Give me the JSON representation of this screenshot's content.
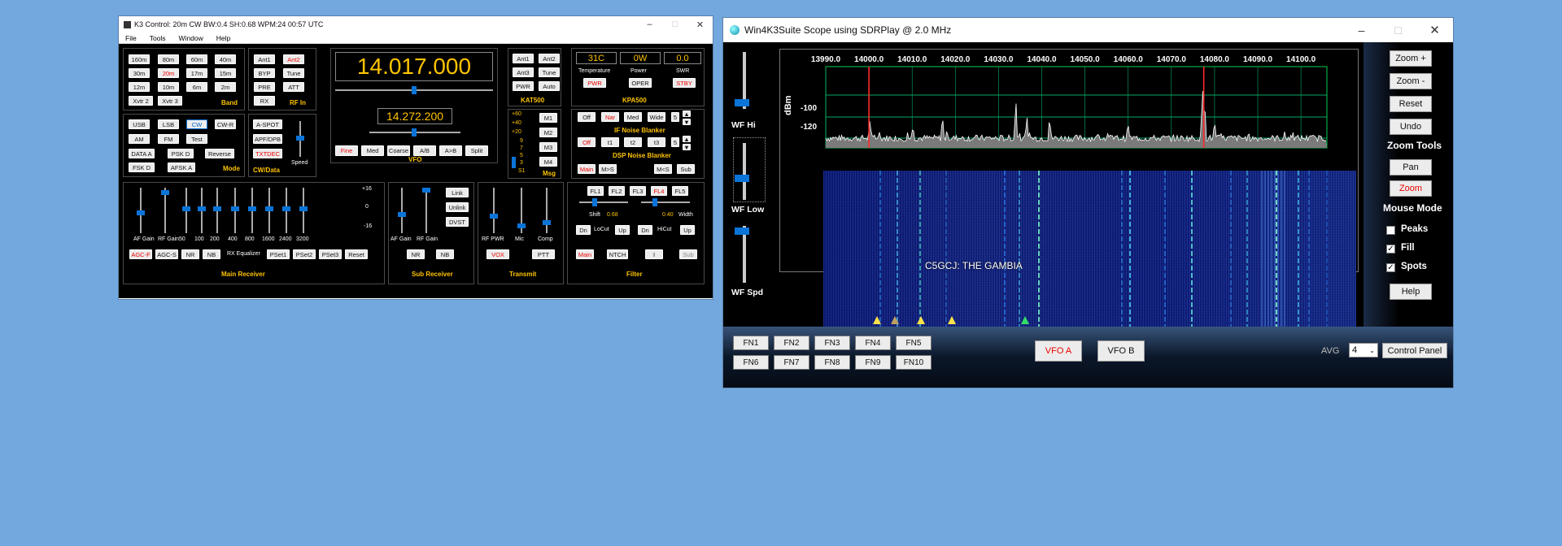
{
  "k3": {
    "title": "K3 Control: 20m CW BW:0.4 SH:0.68 WPM:24  00:57 UTC",
    "menu": [
      "File",
      "Tools",
      "Window",
      "Help"
    ],
    "band": {
      "label": "Band",
      "buttons": [
        "160m",
        "80m",
        "60m",
        "40m",
        "30m",
        "20m",
        "17m",
        "15m",
        "12m",
        "10m",
        "6m",
        "2m",
        "Xvtr 2",
        "Xvtr 3"
      ]
    },
    "rfin": {
      "label": "RF In",
      "buttons": [
        "Ant1",
        "Ant2",
        "BYP",
        "Tune",
        "PRE",
        "ATT",
        "RX"
      ]
    },
    "vfo": {
      "label": "VFO",
      "freq_a": "14.017.000",
      "freq_b": "14.272.200",
      "buttons": [
        "Fine",
        "Med",
        "Coarse",
        "A/B",
        "A>B",
        "Split"
      ]
    },
    "kat": {
      "label": "KAT500",
      "buttons": [
        "Ant1",
        "Ant2",
        "Ant3",
        "Tune",
        "PWR",
        "Auto"
      ]
    },
    "kpa": {
      "label": "KPA500",
      "temp": "31C",
      "power": "0W",
      "swr": "0.0",
      "temp_label": "Temperature",
      "power_label": "Power",
      "swr_label": "SWR",
      "buttons": [
        "PWR",
        "OPER",
        "STBY"
      ]
    },
    "mode": {
      "label": "Mode",
      "buttons": [
        "USB",
        "LSB",
        "CW",
        "CW-R",
        "AM",
        "FM",
        "Test",
        "DATA A",
        "PSK D",
        "Reverse",
        "FSK D",
        "AFSK A"
      ]
    },
    "cwdata": {
      "label": "CW/Data",
      "buttons": [
        "A-SPOT",
        "APF/DPB",
        "TXTDEC"
      ],
      "speed": "Speed"
    },
    "msg": {
      "label": "Msg",
      "buttons": [
        "M1",
        "M2",
        "M3",
        "M4"
      ],
      "meter": [
        "+60",
        "+40",
        "+20",
        "9",
        "7",
        "5",
        "3",
        "S1"
      ]
    },
    "nb": {
      "label": "IF Noise Blanker",
      "buttons": [
        "Off",
        "Nar",
        "Med",
        "Wide"
      ],
      "value": "5"
    },
    "dsp": {
      "label": "DSP Noise Blanker",
      "buttons": [
        "Off",
        "t1",
        "t2",
        "t3"
      ],
      "value": "5",
      "extra": [
        "Main",
        "M>S",
        "M<S",
        "Sub"
      ]
    },
    "mainrx": {
      "label": "Main Receiver",
      "sliders": [
        "AF Gain",
        "RF Gain",
        "50",
        "100",
        "200",
        "400",
        "800",
        "1600",
        "2400",
        "3200"
      ],
      "eq_scale": [
        "+16",
        "0",
        "-16"
      ],
      "eq_label": "RX Equalizer",
      "buttons": [
        "AGC-F",
        "AGC-S",
        "NR",
        "NB",
        "PSet1",
        "PSet2",
        "PSet3",
        "Reset"
      ]
    },
    "subrx": {
      "label": "Sub Receiver",
      "sliders": [
        "AF Gain",
        "RF Gain"
      ],
      "buttons": [
        "Link",
        "Unlink",
        "DVST",
        "NR",
        "NB"
      ]
    },
    "tx": {
      "label": "Transmit",
      "sliders": [
        "RF PWR",
        "Mic",
        "Comp"
      ],
      "buttons": [
        "VOX",
        "PTT"
      ]
    },
    "filter": {
      "label": "Filter",
      "buttons": [
        "FL1",
        "FL2",
        "FL3",
        "FL4",
        "FL5"
      ],
      "shift": "Shift",
      "shift_val": "0.68",
      "width_val": "0.40",
      "width": "Width",
      "locut": "LoCut",
      "hicut": "HiCut",
      "dn": "Dn",
      "up": "Up",
      "bottom": [
        "Main",
        "NTCH",
        "I",
        "Sub"
      ]
    }
  },
  "scope": {
    "title": "Win4K3Suite Scope using SDRPlay @ 2.0 MHz",
    "freq_ticks": [
      "13990.0",
      "14000.0",
      "14010.0",
      "14020.0",
      "14030.0",
      "14040.0",
      "14050.0",
      "14060.0",
      "14070.0",
      "14080.0",
      "14090.0",
      "14100.0"
    ],
    "dbm_ticks": [
      "-100",
      "-120"
    ],
    "dbm_label": "dBm",
    "wf_hi": "WF Hi",
    "wf_low": "WF Low",
    "wf_spd": "WF Spd",
    "spot": "C5GCJ: THE GAMBIA",
    "zoom_in": "Zoom +",
    "zoom_out": "Zoom -",
    "reset": "Reset",
    "undo": "Undo",
    "zoom_tools": "Zoom Tools",
    "pan": "Pan",
    "zoom": "Zoom",
    "mouse_mode": "Mouse Mode",
    "peaks": "Peaks",
    "fill": "Fill",
    "spots": "Spots",
    "help": "Help",
    "fn": [
      "FN1",
      "FN2",
      "FN3",
      "FN4",
      "FN5",
      "FN6",
      "FN7",
      "FN8",
      "FN9",
      "FN10"
    ],
    "vfo_a": "VFO A",
    "vfo_b": "VFO B",
    "avg_label": "AVG",
    "avg_value": "4",
    "control_panel": "Control Panel",
    "colors": {
      "marker": "#ff2a2a",
      "trace": "#ffffff",
      "waterfall": "#0a1a7a",
      "accent": "#0a74d8"
    }
  }
}
